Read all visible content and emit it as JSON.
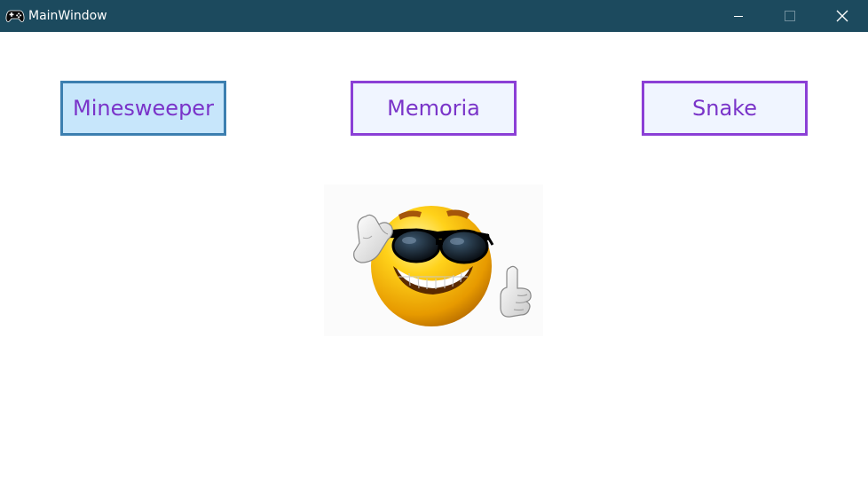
{
  "window": {
    "title": "MainWindow",
    "app_icon": "gamepad-icon",
    "controls": {
      "minimize": "minimize-icon",
      "maximize": "maximize-icon",
      "close": "close-icon"
    },
    "titlebar_color": "#1c4a5e"
  },
  "buttons": {
    "minesweeper": "Minesweeper",
    "memoria": "Memoria",
    "snake": "Snake"
  },
  "colors": {
    "button_border": "#8b3fd6",
    "button_text": "#7a34c9",
    "button_background": "#f0f5ff",
    "active_button_border": "#3c7fb0",
    "active_button_background": "#c7e6fb"
  },
  "image": {
    "icon": "cool-smiley-sunglasses-thumbs-up-icon"
  }
}
